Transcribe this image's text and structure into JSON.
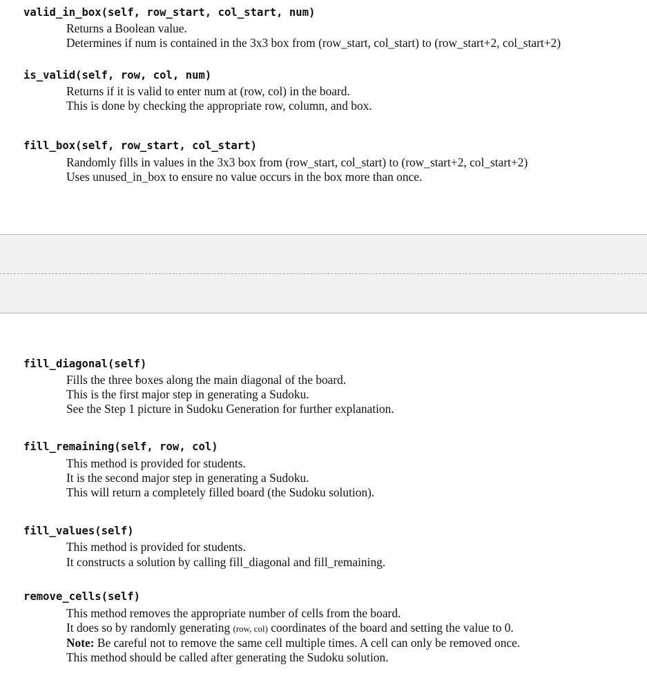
{
  "methods_top": [
    {
      "signature": "valid_in_box(self, row_start, col_start, num)",
      "lines": [
        "Returns a Boolean value.",
        "Determines if num is contained in the 3x3 box from (row_start, col_start) to (row_start+2, col_start+2)"
      ]
    },
    {
      "signature": "is_valid(self, row, col, num)",
      "lines": [
        "Returns if it is valid to enter num at (row, col) in the board.",
        "This is done by checking the appropriate row, column, and box."
      ]
    },
    {
      "signature": "fill_box(self, row_start, col_start)",
      "lines": [
        "Randomly fills in values in the 3x3 box from (row_start, col_start) to (row_start+2, col_start+2)",
        "Uses unused_in_box to ensure no value occurs in the box more than once."
      ]
    }
  ],
  "methods_bottom": [
    {
      "signature": "fill_diagonal(self)",
      "lines": [
        "Fills the three boxes along the main diagonal of the board.",
        "This is the first major step in generating a Sudoku.",
        "See the Step 1 picture in Sudoku Generation for further explanation."
      ]
    },
    {
      "signature": "fill_remaining(self, row, col)",
      "lines": [
        "This method is provided for students.",
        "It is the second major step in generating a Sudoku.",
        "This will return a completely filled board (the Sudoku solution)."
      ]
    },
    {
      "signature": "fill_values(self)",
      "lines": [
        "This method is provided for students.",
        "It constructs a solution by calling fill_diagonal and fill_remaining."
      ]
    },
    {
      "signature": "remove_cells(self)",
      "lines": [
        "This method removes the appropriate number of cells from the board."
      ],
      "line2_parts": {
        "before": "It does so by randomly generating ",
        "small": "(row, col)",
        "after": " coordinates of the board and setting the value to 0."
      },
      "note_label": "Note:",
      "note_text": " Be careful not to remove the same cell multiple times. A cell can only be removed once.",
      "last_line": "This method should be called after generating the Sudoku solution."
    }
  ]
}
